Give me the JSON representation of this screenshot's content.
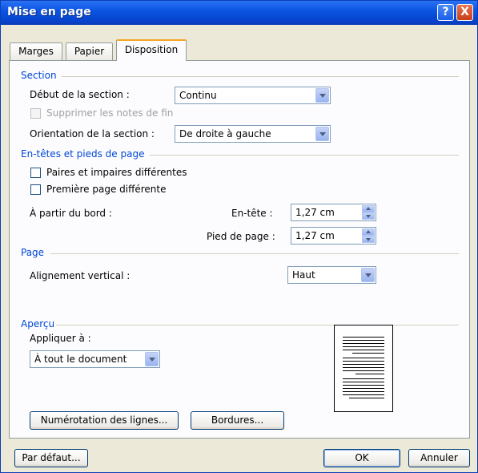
{
  "window": {
    "title": "Mise en page",
    "help_symbol": "?",
    "close_symbol": "X"
  },
  "tabs": [
    {
      "label": "Marges"
    },
    {
      "label": "Papier"
    },
    {
      "label": "Disposition",
      "active": true
    }
  ],
  "section": {
    "group_title": "Section",
    "start_label": "Début de la section :",
    "start_value": "Continu",
    "suppress_endnotes_label": "Supprimer les notes de fin",
    "orientation_label": "Orientation de la section :",
    "orientation_value": "De droite à gauche"
  },
  "headers": {
    "group_title": "En-têtes et pieds de page",
    "odd_even_label": "Paires et impaires différentes",
    "first_page_label": "Première page différente",
    "from_edge_label": "À partir du bord :",
    "header_label": "En-tête :",
    "header_value": "1,27 cm",
    "footer_label": "Pied de page :",
    "footer_value": "1,27 cm"
  },
  "page": {
    "group_title": "Page",
    "valign_label": "Alignement vertical :",
    "valign_value": "Haut"
  },
  "preview": {
    "group_title": "Aperçu",
    "apply_label": "Appliquer à :",
    "apply_value": "À tout le document"
  },
  "buttons": {
    "line_numbers": "Numérotation des lignes...",
    "borders": "Bordures...",
    "default": "Par défaut...",
    "ok": "OK",
    "cancel": "Annuler"
  },
  "colors": {
    "title_bar": "#0a55e3",
    "group_title": "#0046d5",
    "active_tab_accent": "#f5a623"
  }
}
